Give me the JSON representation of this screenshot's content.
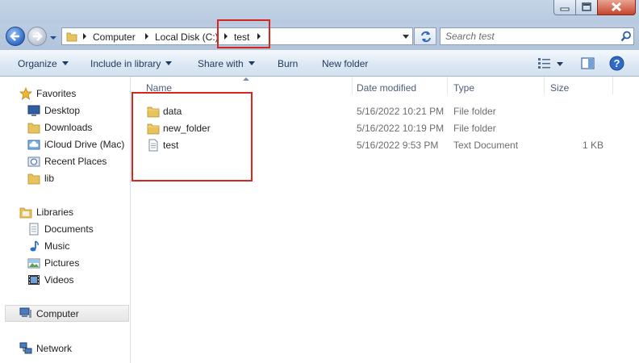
{
  "window": {
    "controls": [
      "minimize",
      "maximize",
      "close"
    ]
  },
  "navigation": {
    "breadcrumbs": [
      "Computer",
      "Local Disk (C:)",
      "test"
    ],
    "search": {
      "placeholder": "Search test"
    }
  },
  "toolbar": {
    "organize": "Organize",
    "include_in_library": "Include in library",
    "share_with": "Share with",
    "burn": "Burn",
    "new_folder": "New folder"
  },
  "sidebar": {
    "favorites": {
      "label": "Favorites",
      "items": [
        "Desktop",
        "Downloads",
        "iCloud Drive (Mac)",
        "Recent Places",
        "lib"
      ]
    },
    "libraries": {
      "label": "Libraries",
      "items": [
        "Documents",
        "Music",
        "Pictures",
        "Videos"
      ]
    },
    "computer": "Computer",
    "network": "Network"
  },
  "file_list": {
    "columns": [
      "Name",
      "Date modified",
      "Type",
      "Size"
    ],
    "rows": [
      {
        "name": "data",
        "date": "5/16/2022 10:21 PM",
        "type": "File folder",
        "size": "",
        "icon": "folder-icon"
      },
      {
        "name": "new_folder",
        "date": "5/16/2022 10:19 PM",
        "type": "File folder",
        "size": "",
        "icon": "folder-icon"
      },
      {
        "name": "test",
        "date": "5/16/2022 9:53 PM",
        "type": "Text Document",
        "size": "1 KB",
        "icon": "text-document-icon"
      }
    ]
  },
  "colors": {
    "highlight": "#d8261f",
    "folder": "#e8c25a",
    "chrome": "#b6c9df"
  }
}
